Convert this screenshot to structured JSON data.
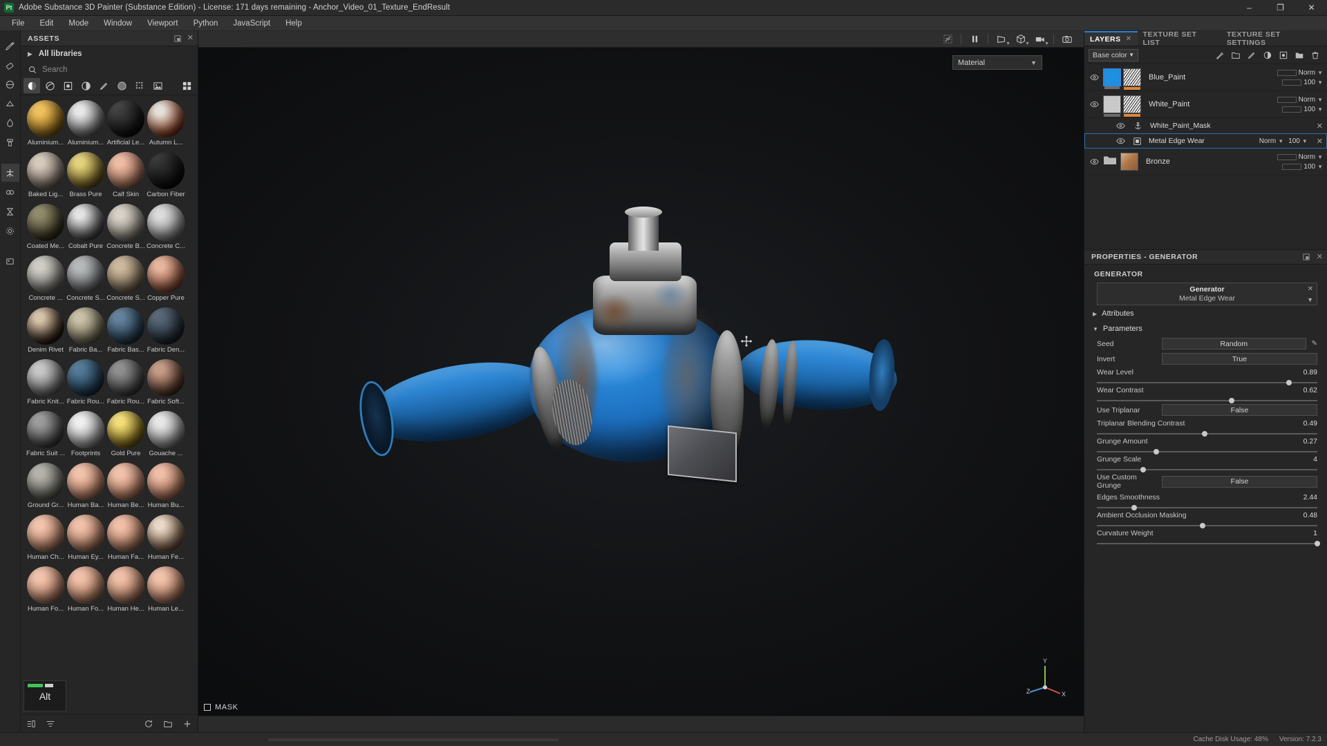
{
  "titlebar": {
    "app_badge": "Pt",
    "title": "Adobe Substance 3D Painter (Substance Edition) - License: 171 days remaining - Anchor_Video_01_Texture_EndResult",
    "minimize": "–",
    "maximize": "❐",
    "close": "✕"
  },
  "menubar": {
    "items": [
      "File",
      "Edit",
      "Mode",
      "Window",
      "Viewport",
      "Python",
      "JavaScript",
      "Help"
    ]
  },
  "assets": {
    "panel_title": "ASSETS",
    "library_label": "All libraries",
    "search_placeholder": "Search",
    "search_value": "",
    "filters": [
      {
        "name": "materials-filter",
        "selected": true
      },
      {
        "name": "smart-materials-filter",
        "selected": false
      },
      {
        "name": "masks-filter",
        "selected": false
      },
      {
        "name": "smart-masks-filter",
        "selected": false
      },
      {
        "name": "brushes-filter",
        "selected": false
      },
      {
        "name": "alphas-filter",
        "selected": false
      },
      {
        "name": "textures-filter",
        "selected": false
      },
      {
        "name": "environments-filter",
        "selected": false
      },
      {
        "name": "grid-view-toggle",
        "selected": false
      }
    ],
    "alt_badge": "Alt",
    "items": [
      {
        "label": "Aluminium...",
        "c1": "#f0c05a",
        "c2": "#8a6415"
      },
      {
        "label": "Aluminium...",
        "c1": "#e8e8e8",
        "c2": "#6d6d6d"
      },
      {
        "label": "Artificial Le...",
        "c1": "#3a3a3a",
        "c2": "#0e0e0e"
      },
      {
        "label": "Autumn L...",
        "c1": "#e6e2da",
        "c2": "#8a3a1c"
      },
      {
        "label": "Baked Lig...",
        "c1": "#d6cabb",
        "c2": "#7d7066"
      },
      {
        "label": "Brass Pure",
        "c1": "#e3d27a",
        "c2": "#6e5a1e"
      },
      {
        "label": "Calf Skin",
        "c1": "#f0bba4",
        "c2": "#9c6a54"
      },
      {
        "label": "Carbon Fiber",
        "c1": "#2e2e2e",
        "c2": "#0a0a0a"
      },
      {
        "label": "Coated Me...",
        "c1": "#8d8868",
        "c2": "#332f1d"
      },
      {
        "label": "Cobalt Pure",
        "c1": "#e4e4e4",
        "c2": "#4c4c4c"
      },
      {
        "label": "Concrete B...",
        "c1": "#d8d2c8",
        "c2": "#8b857b"
      },
      {
        "label": "Concrete C...",
        "c1": "#dcdcdc",
        "c2": "#8f8f8f"
      },
      {
        "label": "Concrete ...",
        "c1": "#cfcdc6",
        "c2": "#7f7d77"
      },
      {
        "label": "Concrete S...",
        "c1": "#b6b9ba",
        "c2": "#6a6d6f"
      },
      {
        "label": "Concrete S...",
        "c1": "#cdb89c",
        "c2": "#7c6b55"
      },
      {
        "label": "Copper Pure",
        "c1": "#e8b59c",
        "c2": "#8a4f3a"
      },
      {
        "label": "Denim Rivet",
        "c1": "#d7c3a8",
        "c2": "#2a1a10"
      },
      {
        "label": "Fabric Ba...",
        "c1": "#c9c0a6",
        "c2": "#6e6852"
      },
      {
        "label": "Fabric Bas...",
        "c1": "#5f7f99",
        "c2": "#22384a"
      },
      {
        "label": "Fabric Den...",
        "c1": "#536272",
        "c2": "#1d2630"
      },
      {
        "label": "Fabric Knit...",
        "c1": "#c6c6c6",
        "c2": "#6e6e6e"
      },
      {
        "label": "Fabric Rou...",
        "c1": "#4f7795",
        "c2": "#1b3246"
      },
      {
        "label": "Fabric Rou...",
        "c1": "#8d8d8d",
        "c2": "#3f3f3f"
      },
      {
        "label": "Fabric Soft...",
        "c1": "#c49a84",
        "c2": "#4e3227"
      },
      {
        "label": "Fabric Suit ...",
        "c1": "#9a9a9a",
        "c2": "#414141"
      },
      {
        "label": "Footprints",
        "c1": "#f0f0f0",
        "c2": "#9a9a9a"
      },
      {
        "label": "Gold Pure",
        "c1": "#f2dd76",
        "c2": "#7a6312"
      },
      {
        "label": "Gouache ...",
        "c1": "#e8e8e8",
        "c2": "#8f8f8f"
      },
      {
        "label": "Ground Gr...",
        "c1": "#b4b2aa",
        "c2": "#60605a"
      },
      {
        "label": "Human Ba...",
        "c1": "#f3c2ab",
        "c2": "#b07a61"
      },
      {
        "label": "Human Be...",
        "c1": "#f3c1aa",
        "c2": "#b07a60"
      },
      {
        "label": "Human Bu...",
        "c1": "#f0bda6",
        "c2": "#ab7258"
      },
      {
        "label": "Human Ch...",
        "c1": "#f3c3ac",
        "c2": "#b17c62"
      },
      {
        "label": "Human Ey...",
        "c1": "#f2c0a9",
        "c2": "#ae7a60"
      },
      {
        "label": "Human Fa...",
        "c1": "#f2bfa8",
        "c2": "#ad795f"
      },
      {
        "label": "Human Fe...",
        "c1": "#ead9c6",
        "c2": "#7a5c46"
      },
      {
        "label": "Human Fo...",
        "c1": "#f3c2ab",
        "c2": "#b07a61"
      },
      {
        "label": "Human Fo...",
        "c1": "#f2c0a9",
        "c2": "#ae7a60"
      },
      {
        "label": "Human He...",
        "c1": "#f1bfa7",
        "c2": "#ac785e"
      },
      {
        "label": "Human Le...",
        "c1": "#f3c2ab",
        "c2": "#b07a61"
      }
    ]
  },
  "viewport": {
    "material_dropdown": "Material",
    "mask_label": "MASK",
    "toolbar_icons": [
      "toggle-visibility-icon",
      "pause-icon",
      "plane-view-icon",
      "cube-view-icon",
      "camera-view-icon",
      "screenshot-icon"
    ],
    "gizmo_axes": [
      "X",
      "Y",
      "Z"
    ]
  },
  "layers_panel": {
    "tabs": [
      {
        "label": "LAYERS",
        "active": true,
        "closable": true
      },
      {
        "label": "TEXTURE SET LIST",
        "active": false,
        "closable": false
      },
      {
        "label": "TEXTURE SET SETTINGS",
        "active": false,
        "closable": false
      }
    ],
    "channel": "Base color",
    "toolbar_icons": [
      "effects-icon",
      "folder-new-icon",
      "paint-layer-icon",
      "fill-layer-icon",
      "mask-icon",
      "folder-icon",
      "trash-icon"
    ],
    "layers": [
      {
        "name": "Blue_Paint",
        "visible": true,
        "type": "fill",
        "blend": "Norm",
        "opacity": "100",
        "swatch": "#1f8fe0",
        "selected_thumb": true,
        "indent": 0
      },
      {
        "name": "White_Paint",
        "visible": true,
        "type": "fill",
        "blend": "Norm",
        "opacity": "100",
        "swatch": "#c9c9c9",
        "selected_thumb": false,
        "indent": 0
      },
      {
        "name": "White_Paint_Mask",
        "visible": true,
        "type": "mask",
        "blend": "",
        "opacity": "",
        "indent": 1
      },
      {
        "name": "Metal Edge Wear",
        "visible": true,
        "type": "generator",
        "blend": "Norm",
        "opacity": "100",
        "indent": 1,
        "selected": true
      },
      {
        "name": "Bronze",
        "visible": true,
        "type": "folder",
        "blend": "Norm",
        "opacity": "100",
        "indent": 0
      }
    ]
  },
  "properties": {
    "header": "PROPERTIES - GENERATOR",
    "section": "GENERATOR",
    "generator_name": "Generator",
    "generator_value": "Metal Edge Wear",
    "groups": [
      {
        "label": "Attributes",
        "expanded": false
      },
      {
        "label": "Parameters",
        "expanded": true
      }
    ],
    "parameters": [
      {
        "name": "Seed",
        "kind": "button",
        "value": "Random",
        "has_pencil": true
      },
      {
        "name": "Invert",
        "kind": "button",
        "value": "True"
      },
      {
        "name": "Wear Level",
        "kind": "slider",
        "value": "0.89",
        "pct": 87
      },
      {
        "name": "Wear Contrast",
        "kind": "slider",
        "value": "0.62",
        "pct": 61
      },
      {
        "name": "Use Triplanar",
        "kind": "button",
        "value": "False"
      },
      {
        "name": "Triplanar Blending Contrast",
        "kind": "slider",
        "value": "0.49",
        "pct": 49
      },
      {
        "name": "Grunge Amount",
        "kind": "slider",
        "value": "0.27",
        "pct": 27
      },
      {
        "name": "Grunge Scale",
        "kind": "slider",
        "value": "4",
        "pct": 21
      },
      {
        "name": "Use Custom Grunge",
        "kind": "button",
        "value": "False"
      },
      {
        "name": "Edges Smoothness",
        "kind": "slider",
        "value": "2.44",
        "pct": 17
      },
      {
        "name": "Ambient Occlusion Masking",
        "kind": "slider",
        "value": "0.48",
        "pct": 48
      },
      {
        "name": "Curvature Weight",
        "kind": "slider",
        "value": "1",
        "pct": 100
      }
    ]
  },
  "statusbar": {
    "cache_label": "Cache Disk Usage:",
    "cache_value": "48%",
    "version_label": "Version: 7.2.3"
  }
}
